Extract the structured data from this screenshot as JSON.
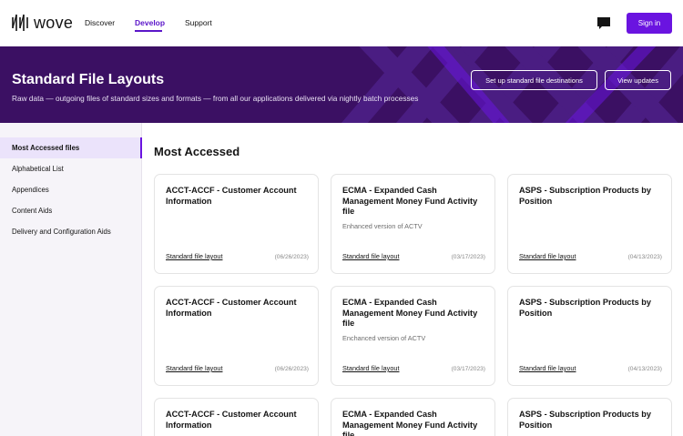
{
  "nav": {
    "logo_text": "wove",
    "links": [
      {
        "label": "Discover"
      },
      {
        "label": "Develop"
      },
      {
        "label": "Support"
      }
    ],
    "signin_label": "Sign in"
  },
  "hero": {
    "title": "Standard File Layouts",
    "subtitle": "Raw data — outgoing files of standard sizes and formats — from all our applications delivered via nightly batch processes",
    "btn_destinations": "Set up standard file destinations",
    "btn_updates": "View updates"
  },
  "sidebar": {
    "items": [
      {
        "label": "Most Accessed files"
      },
      {
        "label": "Alphabetical List"
      },
      {
        "label": "Appendices"
      },
      {
        "label": "Content Aids"
      },
      {
        "label": "Delivery and Configuration Aids"
      }
    ]
  },
  "main": {
    "title": "Most Accessed",
    "cards": [
      {
        "title": "ACCT-ACCF - Customer Account Information",
        "desc": "",
        "link": "Standard file layout",
        "date": "(06/26/2023)"
      },
      {
        "title": "ECMA - Expanded Cash Management Money Fund Activity file",
        "desc": "Enhanced version of ACTV",
        "link": "Standard file layout",
        "date": "(03/17/2023)"
      },
      {
        "title": "ASPS - Subscription Products by Position",
        "desc": "",
        "link": "Standard file layout",
        "date": "(04/13/2023)"
      },
      {
        "title": "ACCT-ACCF - Customer Account Information",
        "desc": "",
        "link": "Standard file layout",
        "date": "(06/26/2023)"
      },
      {
        "title": "ECMA - Expanded Cash Management Money Fund Activity file",
        "desc": "Enchanced version of ACTV",
        "link": "Standard file layout",
        "date": "(03/17/2023)"
      },
      {
        "title": "ASPS - Subscription Products by Position",
        "desc": "",
        "link": "Standard file layout",
        "date": "(04/13/2023)"
      },
      {
        "title": "ACCT-ACCF - Customer Account Information",
        "desc": "",
        "link": "",
        "date": ""
      },
      {
        "title": "ECMA - Expanded Cash Management Money Fund Activity file",
        "desc": "",
        "link": "",
        "date": ""
      },
      {
        "title": "ASPS - Subscription Products by Position",
        "desc": "",
        "link": "",
        "date": ""
      }
    ]
  },
  "colors": {
    "brand": "#6a14e0",
    "hero_bg": "#3b1063",
    "sidebar_bg": "#f6f4f9"
  },
  "icons": [
    "wove-logo-icon",
    "chat-icon"
  ]
}
